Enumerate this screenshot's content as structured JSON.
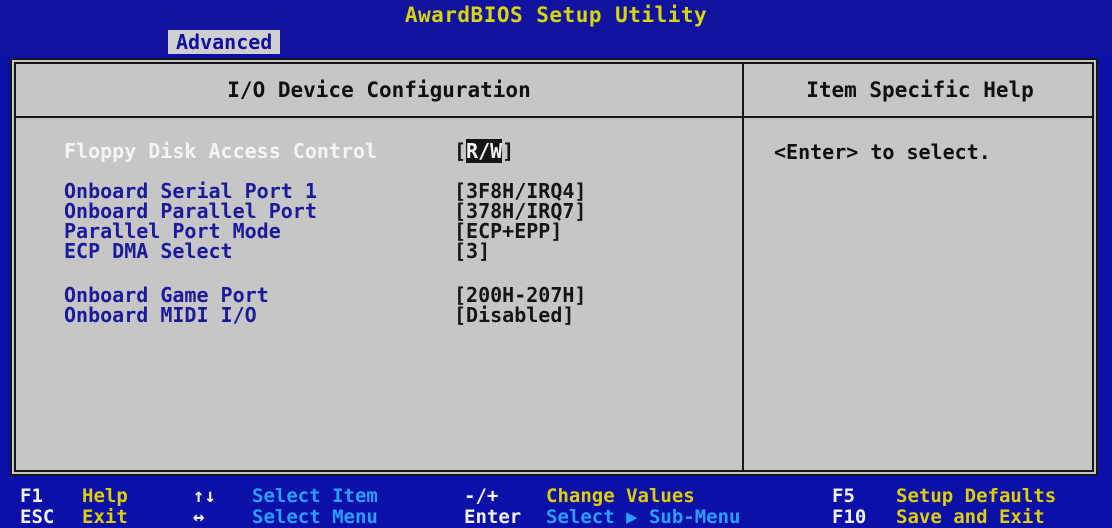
{
  "title": "AwardBIOS Setup Utility",
  "active_tab": "Advanced",
  "section_title": "I/O Device Configuration",
  "help_title": "Item Specific Help",
  "help_text": "<Enter> to select.",
  "items": [
    {
      "label": "Floppy Disk Access Control",
      "open": "[",
      "value": "R/W",
      "close": "]",
      "selected": true
    },
    {
      "label": "Onboard Serial Port 1",
      "value": "[3F8H/IRQ4]"
    },
    {
      "label": "Onboard Parallel Port",
      "value": "[378H/IRQ7]"
    },
    {
      "label": "Parallel Port Mode",
      "value": "[ECP+EPP]"
    },
    {
      "label": "ECP DMA Select",
      "value": "[3]"
    },
    {
      "label": "Onboard Game Port",
      "value": "[200H-207H]"
    },
    {
      "label": "Onboard MIDI I/O",
      "value": "[Disabled]"
    }
  ],
  "footer": [
    {
      "key": "F1",
      "label": "Help"
    },
    {
      "key": "ESC",
      "label": "Exit"
    },
    {
      "key": "↑↓",
      "label": "Select Item"
    },
    {
      "key": "↔",
      "label": "Select Menu"
    },
    {
      "key": "-/+",
      "label": "Change Values"
    },
    {
      "key": "Enter",
      "label": "Select ▶ Sub-Menu"
    },
    {
      "key": "F5",
      "label": "Setup Defaults"
    },
    {
      "key": "F10",
      "label": "Save and Exit"
    }
  ],
  "colors": {
    "background": "#0a10a8",
    "panel": "#c6c6c6",
    "item_text": "#1a1a9a",
    "title_text": "#d8d800",
    "footer_label": "#e0cf00"
  }
}
